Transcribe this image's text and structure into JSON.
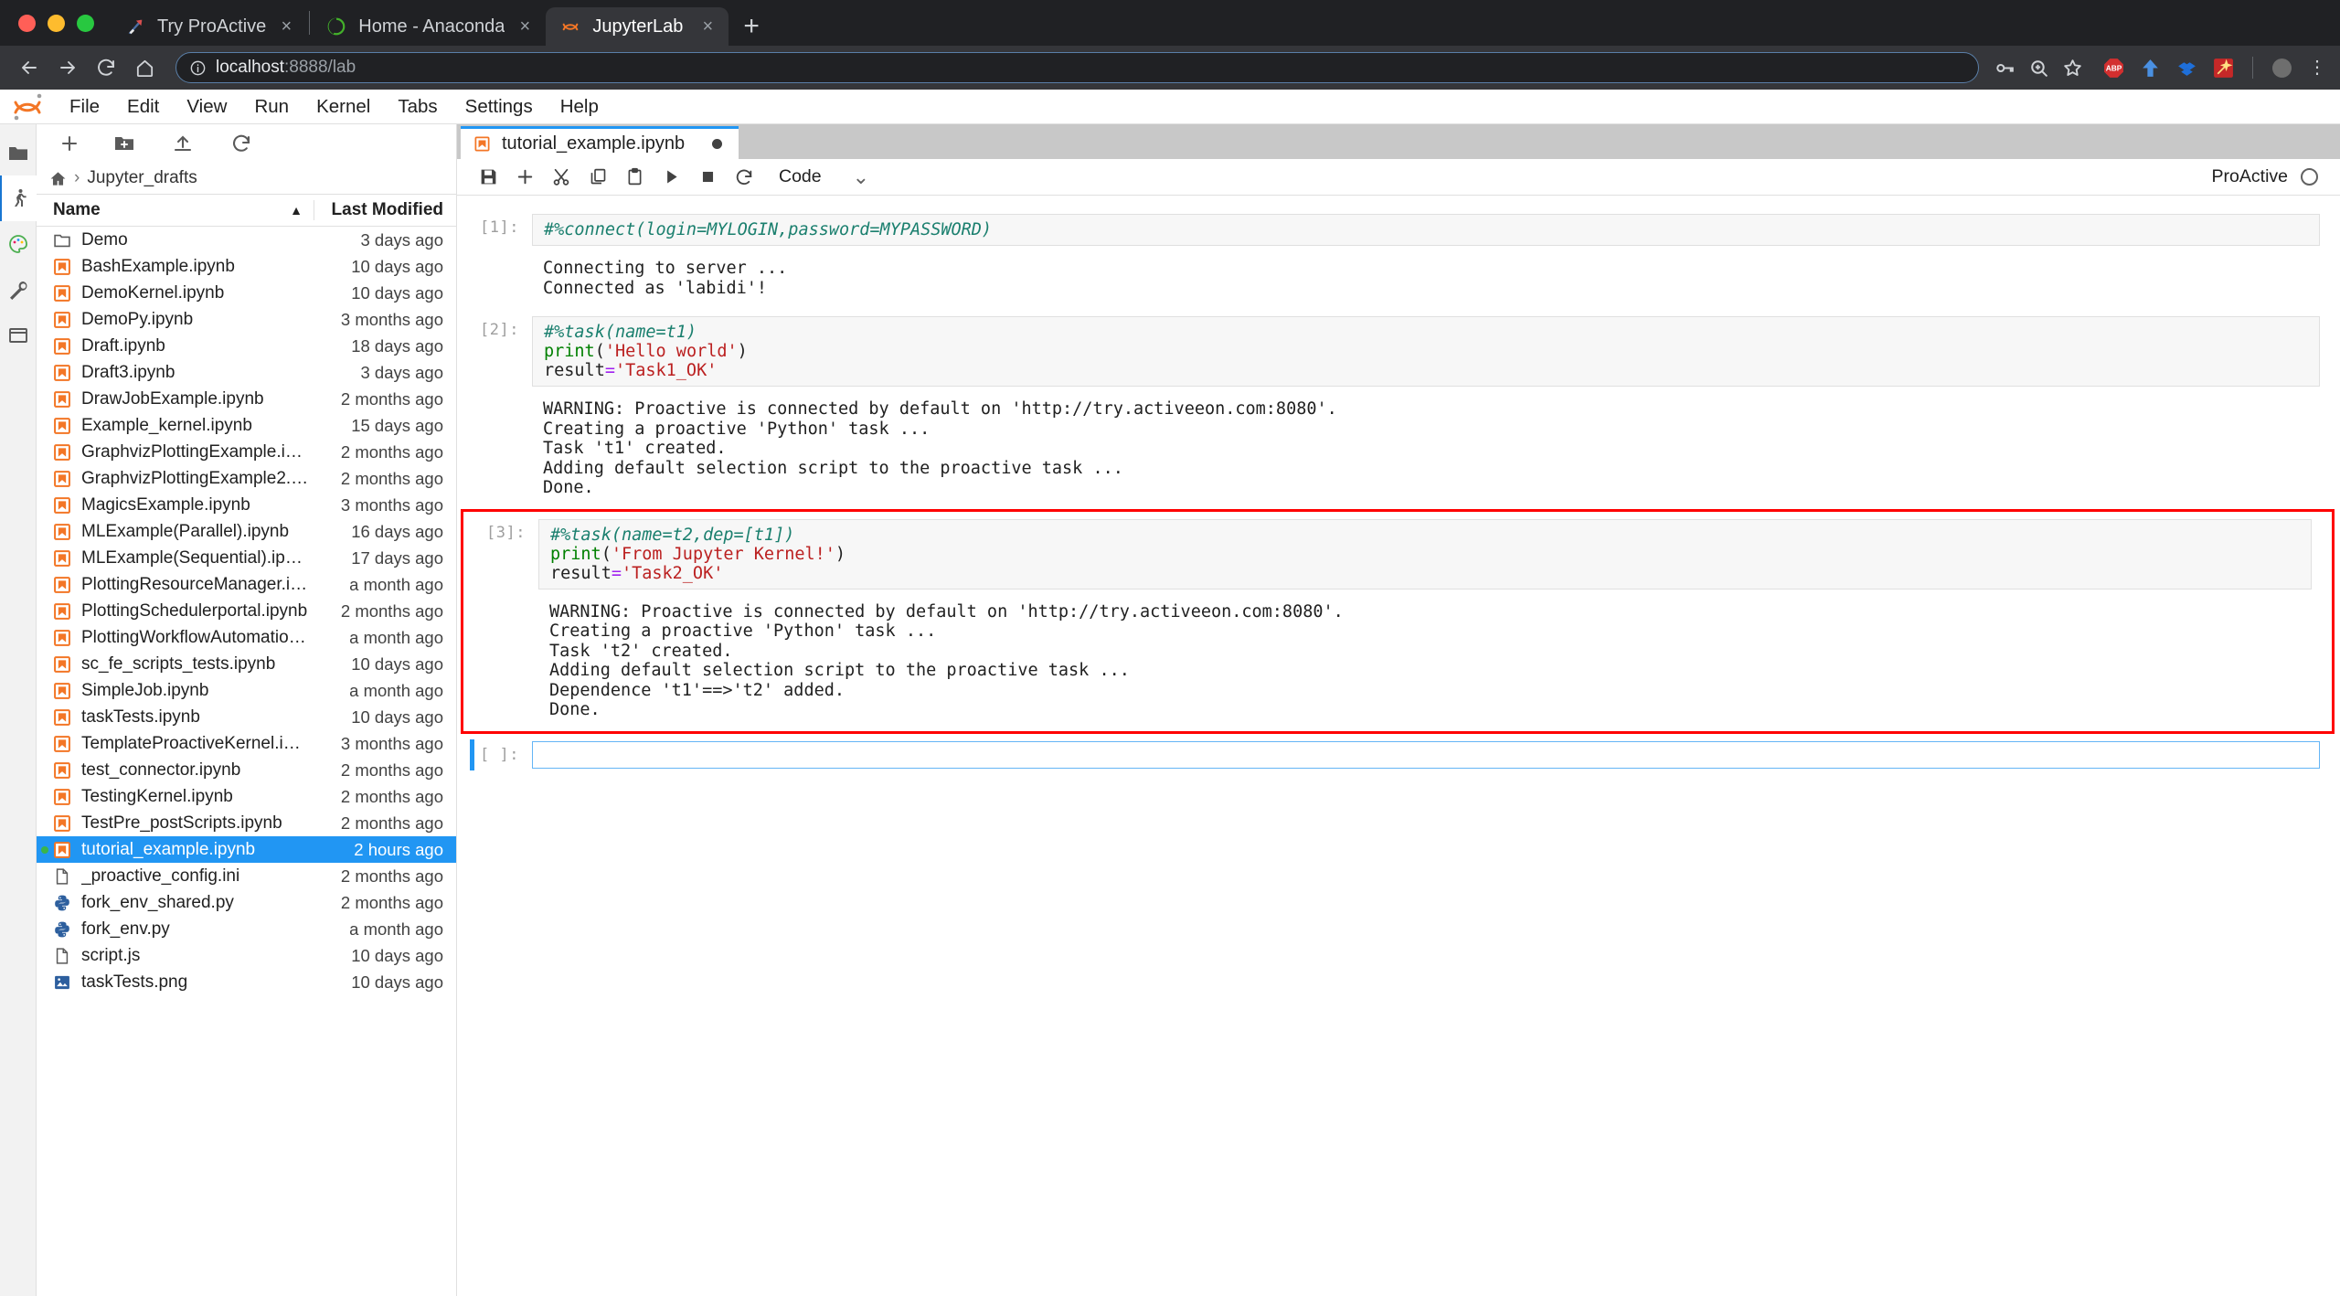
{
  "browser": {
    "tabs": [
      {
        "title": "Try ProActive",
        "favicon": "proactive-icon",
        "active": false
      },
      {
        "title": "Home - Anaconda",
        "favicon": "anaconda-icon",
        "active": false
      },
      {
        "title": "JupyterLab",
        "favicon": "jupyter-icon",
        "active": true
      }
    ],
    "close_label": "×",
    "newtab_label": "+",
    "nav": {
      "back": "←",
      "forward": "→",
      "reload": "↻",
      "home": "⌂"
    },
    "omnibox": {
      "url_host": "localhost",
      "url_rest": ":8888/lab",
      "value": "localhost:8888/lab"
    },
    "extensions": [
      "adblock-icon",
      "dropbox-upload-icon",
      "dropbox-icon",
      "wand-icon",
      "avatar-icon"
    ]
  },
  "jupyter": {
    "menu": [
      "File",
      "Edit",
      "View",
      "Run",
      "Kernel",
      "Tabs",
      "Settings",
      "Help"
    ],
    "activitybar": [
      "folder-icon",
      "running-icon",
      "palette-icon",
      "tools-icon",
      "tabs-icon"
    ],
    "filebrowser": {
      "toolbar": [
        "new-launcher-icon",
        "new-folder-icon",
        "upload-icon",
        "refresh-icon"
      ],
      "breadcrumb_home": "home-icon",
      "breadcrumb_sep": "›",
      "breadcrumb_path": "Jupyter_drafts",
      "columns": {
        "name": "Name",
        "modified": "Last Modified",
        "sort": "▲"
      },
      "items": [
        {
          "name": "Demo",
          "modified": "3 days ago",
          "icon": "folder-icon"
        },
        {
          "name": "BashExample.ipynb",
          "modified": "10 days ago",
          "icon": "notebook-icon"
        },
        {
          "name": "DemoKernel.ipynb",
          "modified": "10 days ago",
          "icon": "notebook-icon"
        },
        {
          "name": "DemoPy.ipynb",
          "modified": "3 months ago",
          "icon": "notebook-icon"
        },
        {
          "name": "Draft.ipynb",
          "modified": "18 days ago",
          "icon": "notebook-icon"
        },
        {
          "name": "Draft3.ipynb",
          "modified": "3 days ago",
          "icon": "notebook-icon"
        },
        {
          "name": "DrawJobExample.ipynb",
          "modified": "2 months ago",
          "icon": "notebook-icon"
        },
        {
          "name": "Example_kernel.ipynb",
          "modified": "15 days ago",
          "icon": "notebook-icon"
        },
        {
          "name": "GraphvizPlottingExample.ipy…",
          "modified": "2 months ago",
          "icon": "notebook-icon"
        },
        {
          "name": "GraphvizPlottingExample2.ip…",
          "modified": "2 months ago",
          "icon": "notebook-icon"
        },
        {
          "name": "MagicsExample.ipynb",
          "modified": "3 months ago",
          "icon": "notebook-icon"
        },
        {
          "name": "MLExample(Parallel).ipynb",
          "modified": "16 days ago",
          "icon": "notebook-icon"
        },
        {
          "name": "MLExample(Sequential).ipynb",
          "modified": "17 days ago",
          "icon": "notebook-icon"
        },
        {
          "name": "PlottingResourceManager.ip…",
          "modified": "a month ago",
          "icon": "notebook-icon"
        },
        {
          "name": "PlottingSchedulerportal.ipynb",
          "modified": "2 months ago",
          "icon": "notebook-icon"
        },
        {
          "name": "PlottingWorkflowAutomation…",
          "modified": "a month ago",
          "icon": "notebook-icon"
        },
        {
          "name": "sc_fe_scripts_tests.ipynb",
          "modified": "10 days ago",
          "icon": "notebook-icon"
        },
        {
          "name": "SimpleJob.ipynb",
          "modified": "a month ago",
          "icon": "notebook-icon"
        },
        {
          "name": "taskTests.ipynb",
          "modified": "10 days ago",
          "icon": "notebook-icon"
        },
        {
          "name": "TemplateProactiveKernel.ipy…",
          "modified": "3 months ago",
          "icon": "notebook-icon"
        },
        {
          "name": "test_connector.ipynb",
          "modified": "2 months ago",
          "icon": "notebook-icon"
        },
        {
          "name": "TestingKernel.ipynb",
          "modified": "2 months ago",
          "icon": "notebook-icon"
        },
        {
          "name": "TestPre_postScripts.ipynb",
          "modified": "2 months ago",
          "icon": "notebook-icon"
        },
        {
          "name": "tutorial_example.ipynb",
          "modified": "2 hours ago",
          "icon": "notebook-icon",
          "selected": true,
          "running": true
        },
        {
          "name": "_proactive_config.ini",
          "modified": "2 months ago",
          "icon": "file-icon"
        },
        {
          "name": "fork_env_shared.py",
          "modified": "2 months ago",
          "icon": "python-icon"
        },
        {
          "name": "fork_env.py",
          "modified": "a month ago",
          "icon": "python-icon"
        },
        {
          "name": "script.js",
          "modified": "10 days ago",
          "icon": "file-icon"
        },
        {
          "name": "taskTests.png",
          "modified": "10 days ago",
          "icon": "image-icon"
        }
      ]
    },
    "notebook": {
      "tab_title": "tutorial_example.ipynb",
      "tab_icon": "notebook-icon",
      "dirty": true,
      "toolbar": [
        "save-icon",
        "insert-cell-icon",
        "cut-icon",
        "copy-icon",
        "paste-icon",
        "run-icon",
        "stop-icon",
        "restart-icon"
      ],
      "celltype": "Code",
      "celltype_chevron": "˅",
      "kernel_name": "ProActive",
      "kernel_status": "idle",
      "cells": [
        {
          "prompt": "[1]:",
          "code_magic": "#%connect(login=MYLOGIN,password=MYPASSWORD)",
          "output": "Connecting to server ...\nConnected as 'labidi'!",
          "highlighted": false,
          "active": false
        },
        {
          "prompt": "[2]:",
          "code_magic": "#%task(name=t1)",
          "code_line2_fn": "print",
          "code_line2_str": "'Hello world'",
          "code_line3_var": "result",
          "code_line3_str": "'Task1_OK'",
          "output": "WARNING: Proactive is connected by default on 'http://try.activeeon.com:8080'.\nCreating a proactive 'Python' task ...\nTask 't1' created.\nAdding default selection script to the proactive task ...\nDone.",
          "highlighted": false,
          "active": false
        },
        {
          "prompt": "[3]:",
          "code_magic": "#%task(name=t2,dep=[t1])",
          "code_line2_fn": "print",
          "code_line2_str": "'From Jupyter Kernel!'",
          "code_line3_var": "result",
          "code_line3_str": "'Task2_OK'",
          "output": "WARNING: Proactive is connected by default on 'http://try.activeeon.com:8080'.\nCreating a proactive 'Python' task ...\nTask 't2' created.\nAdding default selection script to the proactive task ...\nDependence 't1'==>'t2' added.\nDone.",
          "highlighted": true,
          "active": false
        },
        {
          "prompt": "[ ]:",
          "code_magic": "",
          "output": "",
          "highlighted": false,
          "active": true,
          "empty": true
        }
      ]
    }
  },
  "colors": {
    "accent_blue": "#2196f3",
    "highlight_red": "#ff0000",
    "jupyter_orange": "#f37626",
    "selected_row": "#2196f3",
    "running_green": "#3ab54a"
  }
}
